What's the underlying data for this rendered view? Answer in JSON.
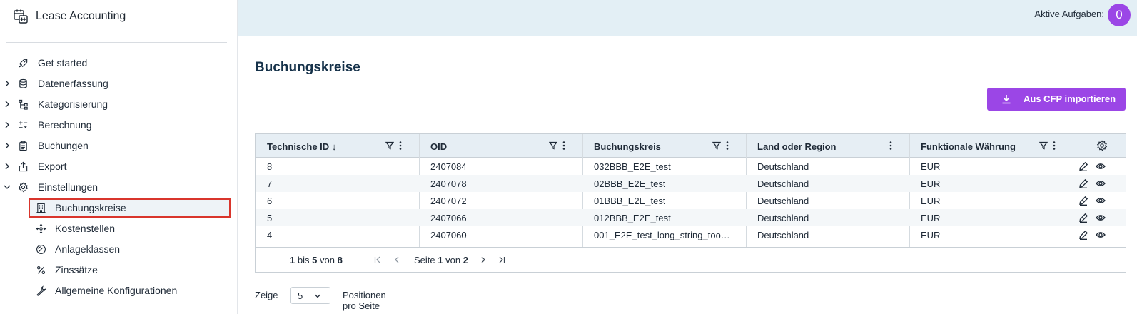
{
  "app": {
    "title": "Lease Accounting"
  },
  "topbar": {
    "tasks_label": "Aktive Aufgaben:",
    "tasks_count": "0"
  },
  "sidebar": {
    "items": [
      {
        "label": "Get started",
        "icon": "rocket-icon",
        "expandable": false
      },
      {
        "label": "Datenerfassung",
        "icon": "database-icon",
        "expandable": true
      },
      {
        "label": "Kategorisierung",
        "icon": "hierarchy-icon",
        "expandable": true
      },
      {
        "label": "Berechnung",
        "icon": "calculator-icon",
        "expandable": true
      },
      {
        "label": "Buchungen",
        "icon": "clipboard-icon",
        "expandable": true
      },
      {
        "label": "Export",
        "icon": "export-icon",
        "expandable": true
      },
      {
        "label": "Einstellungen",
        "icon": "gear-icon",
        "expandable": true,
        "expanded": true
      }
    ],
    "sub_items": [
      {
        "label": "Buchungskreise",
        "icon": "building-icon",
        "active": true
      },
      {
        "label": "Kostenstellen",
        "icon": "cost-center-icon"
      },
      {
        "label": "Anlageklassen",
        "icon": "gauge-icon"
      },
      {
        "label": "Zinssätze",
        "icon": "percent-icon"
      },
      {
        "label": "Allgemeine Konfigurationen",
        "icon": "wrench-icon"
      }
    ]
  },
  "main": {
    "title": "Buchungskreise",
    "import_button": "Aus CFP importieren",
    "columns": [
      "Technische ID",
      "OID",
      "Buchungskreis",
      "Land oder Region",
      "Funktionale Währung"
    ],
    "sort_indicator": "↓",
    "rows": [
      [
        "8",
        "2407084",
        "032BBB_E2E_test",
        "Deutschland",
        "EUR"
      ],
      [
        "7",
        "2407078",
        "02BBB_E2E_test",
        "Deutschland",
        "EUR"
      ],
      [
        "6",
        "2407072",
        "01BBB_E2E_test",
        "Deutschland",
        "EUR"
      ],
      [
        "5",
        "2407066",
        "012BBB_E2E_test",
        "Deutschland",
        "EUR"
      ],
      [
        "4",
        "2407060",
        "001_E2E_test_long_string_too…",
        "Deutschland",
        "EUR"
      ]
    ],
    "pagination": {
      "from": "1",
      "bis": "bis",
      "to": "5",
      "von": "von",
      "total": "8",
      "seite": "Seite",
      "page": "1",
      "page_von": "von",
      "pages": "2"
    },
    "footer": {
      "zeige": "Zeige",
      "page_size": "5",
      "positions_label": "Positionen pro Seite"
    }
  },
  "colors": {
    "accent": "#9b46e6",
    "topbar": "#e3eff5",
    "header": "#e6eef4",
    "highlight": "#d9352c"
  }
}
